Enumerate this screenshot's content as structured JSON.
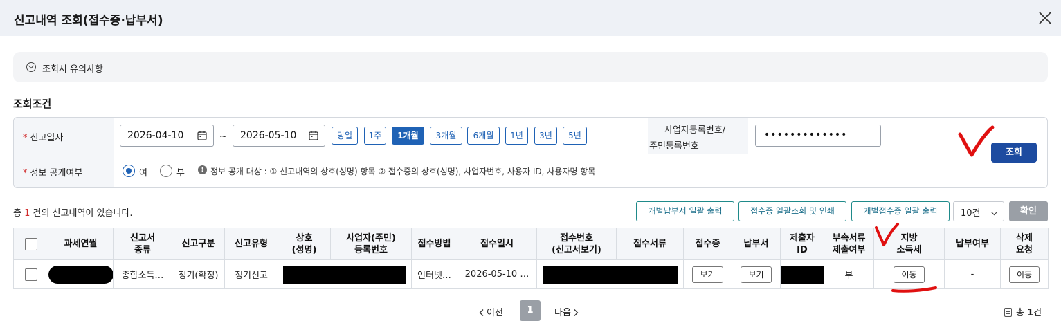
{
  "dialog": {
    "title": "신고내역 조회(접수증·납부서)"
  },
  "notice": {
    "label": "조회시 유의사항"
  },
  "conditions": {
    "section_title": "조회조건",
    "report_date_label": "신고일자",
    "start_date": "2026-04-10",
    "tilde": "~",
    "end_date": "2026-05-10",
    "periods": [
      "당일",
      "1주",
      "1개월",
      "3개월",
      "6개월",
      "1년",
      "3년",
      "5년"
    ],
    "active_period": "1개월",
    "id_label_line1": "사업자등록번호/",
    "id_label_line2": "주민등록번호",
    "id_value": "•••••••••••••",
    "disclosure_label": "정보 공개여부",
    "radio_yes": "여",
    "radio_no": "부",
    "radio_selected": "여",
    "disclosure_note": "정보 공개 대상 : ① 신고내역의 상호(성명) 항목 ② 접수증의 상호(성명), 사업자번호, 사용자 ID, 사용자명 항목",
    "search_button": "조회"
  },
  "results": {
    "count_prefix": "총 ",
    "count": "1",
    "count_suffix": " 건의 신고내역이 있습니다.",
    "btn_bulk_tax_bill": "개별납부서 일괄 출력",
    "btn_receipt_print": "접수증 일괄조회 및 인쇄",
    "btn_bulk_receipt": "개별접수증 일괄 출력",
    "page_size": "10건",
    "confirm_button": "확인"
  },
  "table": {
    "headers": [
      "",
      "과세연월",
      "신고서\n종류",
      "신고구분",
      "신고유형",
      "상호\n(성명)",
      "사업자(주민)\n등록번호",
      "접수방법",
      "접수일시",
      "접수번호\n(신고서보기)",
      "접수서류",
      "접수증",
      "납부서",
      "제출자\nID",
      "부속서류\n제출여부",
      "지방\n소득세",
      "납부여부",
      "삭제\n요청"
    ],
    "row": {
      "report_kind": "종합소득…",
      "report_class": "정기(확정)",
      "report_type": "정기신고",
      "receipt_method": "인터넷…",
      "receipt_datetime": "2026-05-10 …",
      "receipt_view_btn": "보기",
      "tax_bill_view_btn": "보기",
      "attachment_submitted": "부",
      "local_income_tax_btn": "이동",
      "payment_status": "-",
      "delete_request_btn": "이동"
    }
  },
  "pagination": {
    "prev": "이전",
    "current": "1",
    "next": "다음",
    "total_prefix": "총 ",
    "total_count": "1",
    "total_suffix": "건"
  },
  "colors": {
    "primary": "#1f62b5",
    "search_button": "#1d4ba0",
    "teal_button": "#1b6e8a",
    "required": "#d12d2d",
    "annotation": "#e01010"
  },
  "icons": [
    "close-icon",
    "chevron-circle-icon",
    "calendar-icon",
    "info-icon",
    "chevron-down-icon",
    "chevron-left-icon",
    "chevron-right-icon",
    "document-icon"
  ]
}
